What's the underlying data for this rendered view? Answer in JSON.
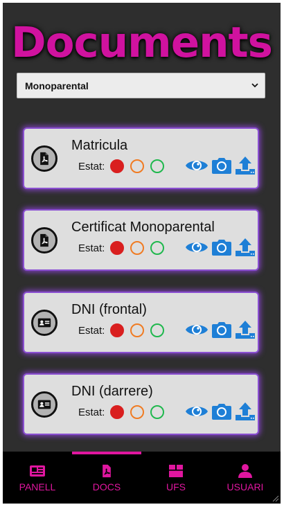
{
  "page": {
    "title": "Documents"
  },
  "filter": {
    "selected": "Monoparental"
  },
  "documents": [
    {
      "title": "Matricula",
      "icon": "pdf-icon",
      "estat_label": "Estat:"
    },
    {
      "title": "Certificat Monoparental",
      "icon": "pdf-icon",
      "estat_label": "Estat:"
    },
    {
      "title": "DNI (frontal)",
      "icon": "id-card-icon",
      "estat_label": "Estat:"
    },
    {
      "title": "DNI (darrere)",
      "icon": "id-card-icon",
      "estat_label": "Estat:"
    }
  ],
  "status_colors": {
    "rejected": "#d91f1f",
    "pending": "#f07b22",
    "approved": "#1fb84d"
  },
  "nav": {
    "items": [
      {
        "label": "PANELL",
        "icon": "newspaper-icon"
      },
      {
        "label": "DOCS",
        "icon": "pdf-icon",
        "active": true
      },
      {
        "label": "UFS",
        "icon": "box-icon"
      },
      {
        "label": "USUARI",
        "icon": "user-icon"
      }
    ]
  },
  "colors": {
    "accent": "#e0169f",
    "card_glow": "#8a4fd1",
    "action_icons": "#1e7fd6",
    "background": "#2e2e2e"
  }
}
